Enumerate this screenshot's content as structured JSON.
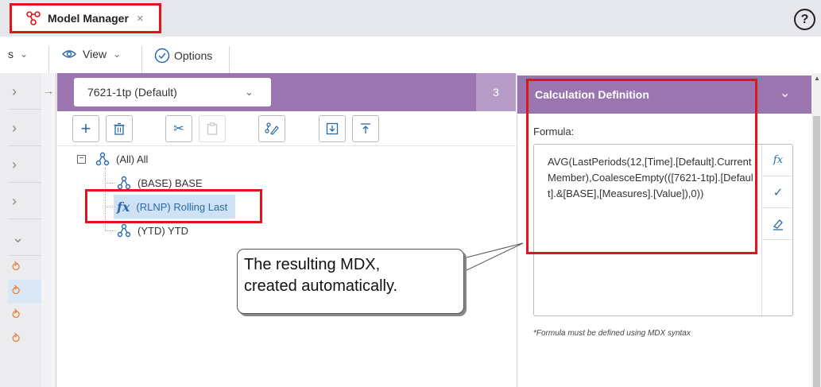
{
  "tab": {
    "title": "Model Manager",
    "close": "×"
  },
  "help": {
    "label": "?"
  },
  "toolbar": {
    "partial_label": "s",
    "view_label": "View",
    "options_label": "Options"
  },
  "model_select": {
    "value": "7621-1tp (Default)"
  },
  "count": "3",
  "tree": {
    "root": "(All) All",
    "children": [
      {
        "label": "(BASE) BASE"
      },
      {
        "label": "(RLNP) Rolling Last",
        "icon": "fx",
        "selected": true
      },
      {
        "label": "(YTD) YTD"
      }
    ]
  },
  "calc": {
    "title": "Calculation Definition",
    "formula_label": "Formula:",
    "formula": "AVG(LastPeriods(12,[Time].[Default].CurrentMember),CoalesceEmpty(([7621-1tp].[Default].&[BASE],[Measures].[Value]),0))",
    "hint": "*Formula must be defined using MDX syntax",
    "fx_tool": "fx"
  },
  "callout": {
    "line1": "The resulting MDX,",
    "line2": "created automatically."
  },
  "colors": {
    "accent_purple": "#9a75b0",
    "highlight_red": "#e0151b",
    "link_blue": "#2b6aa6",
    "share_orange": "#e8803a"
  }
}
